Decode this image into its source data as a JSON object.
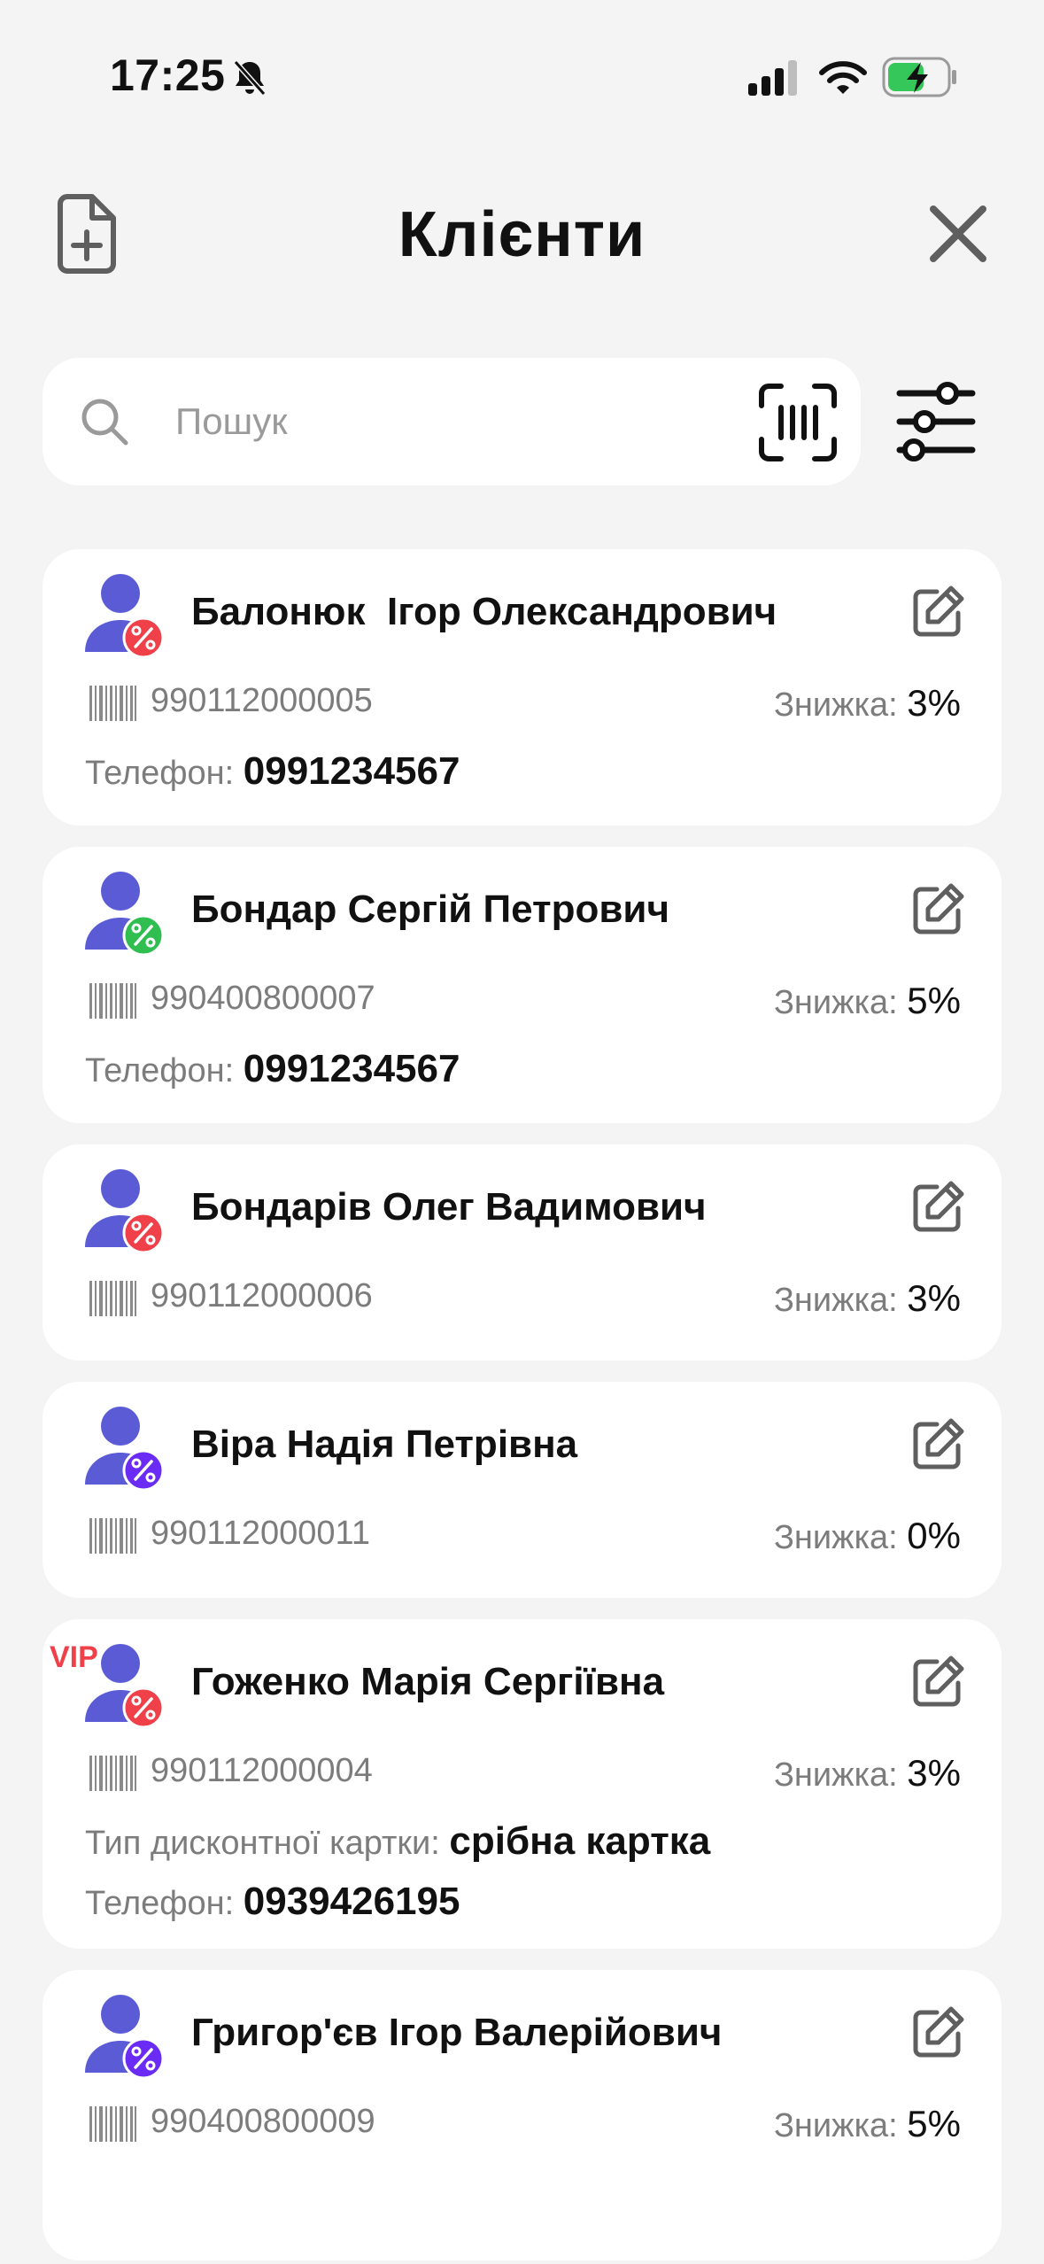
{
  "status_bar": {
    "time": "17:25",
    "icons": [
      "bell-slash-icon",
      "signal-icon",
      "wifi-icon",
      "battery-charging-icon"
    ]
  },
  "header": {
    "title": "Клієнти",
    "left_icon": "new-document-icon",
    "right_icon": "close-icon"
  },
  "search": {
    "placeholder": "Пошук",
    "value": "",
    "scan_icon": "barcode-scan-icon",
    "filter_icon": "filter-sliders-icon"
  },
  "labels": {
    "discount": "Знижка:",
    "phone": "Телефон:",
    "card_type": "Тип дисконтної картки:"
  },
  "colors": {
    "badge_red": "#f0414a",
    "badge_green": "#2fbe4f",
    "badge_purple": "#6a2cf5",
    "avatar": "#5b5bd6",
    "vip": "#f0414a",
    "battery_fill": "#35c759"
  },
  "clients": [
    {
      "name": "Балонюк  Ігор Олександрович",
      "code": "990112000005",
      "discount": "3%",
      "phone": "0991234567",
      "badge": "red"
    },
    {
      "name": "Бондар Сергій Петрович",
      "code": "990400800007",
      "discount": "5%",
      "phone": "0991234567",
      "badge": "green"
    },
    {
      "name": "Бондарів Олег Вадимович",
      "code": "990112000006",
      "discount": "3%",
      "badge": "red"
    },
    {
      "name": "Віра Надія Петрівна",
      "code": "990112000011",
      "discount": "0%",
      "badge": "purple"
    },
    {
      "name": "Гоженко Марія Сергіївна",
      "code": "990112000004",
      "discount": "3%",
      "vip": "VIP",
      "card_type": "срібна картка",
      "phone": "0939426195",
      "badge": "red"
    },
    {
      "name": "Григор'єв Ігор Валерійович",
      "code": "990400800009",
      "discount": "5%",
      "badge": "purple"
    }
  ]
}
